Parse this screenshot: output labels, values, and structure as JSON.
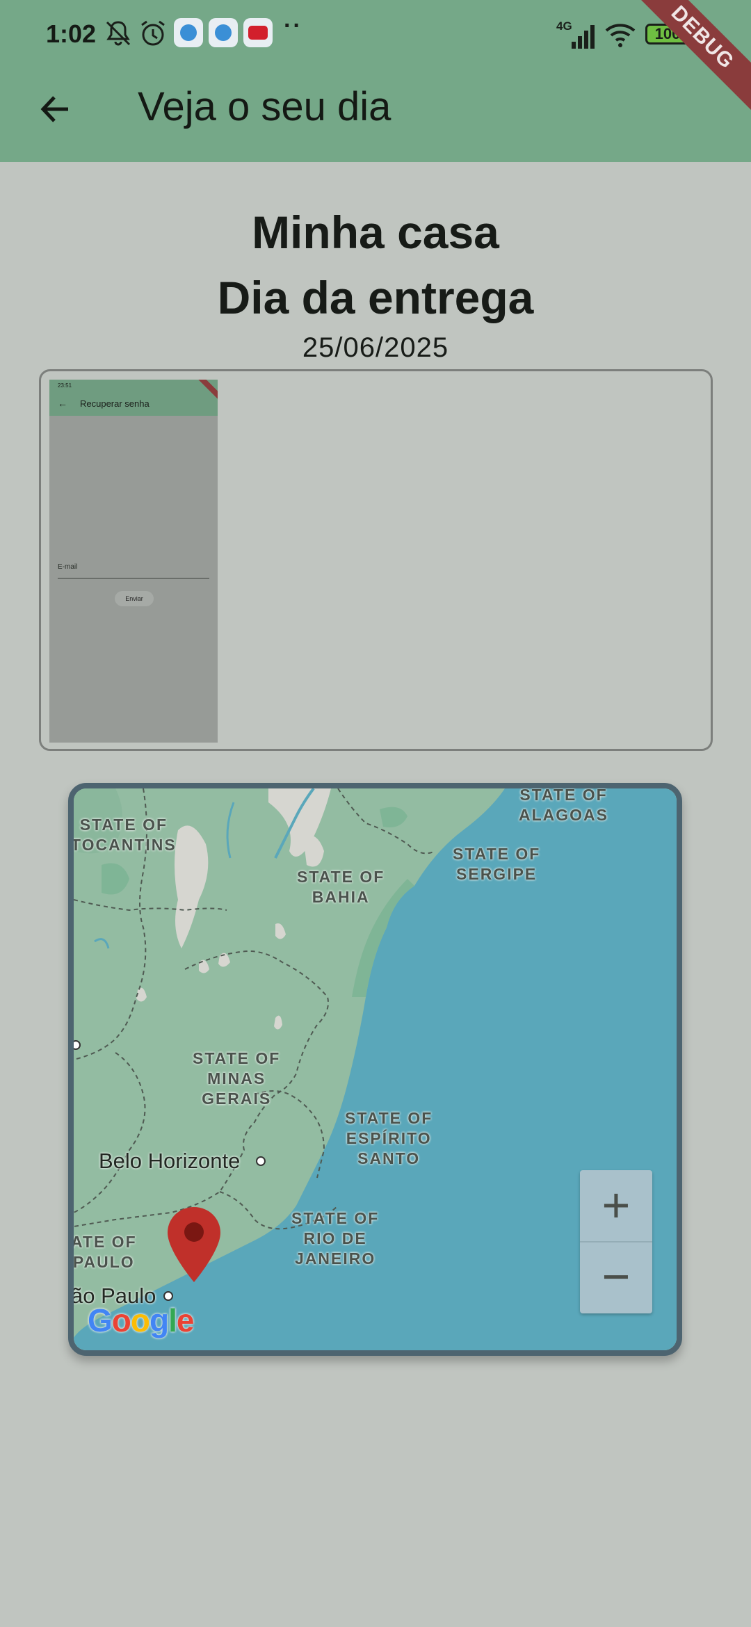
{
  "status_bar": {
    "time": "1:02",
    "network": "4G",
    "battery": "100",
    "icons": [
      "mute-icon",
      "alarm-icon",
      "edge-icon",
      "edge-icon",
      "youtube-icon",
      "more-dots-icon",
      "signal-icon",
      "wifi-icon",
      "battery-icon"
    ]
  },
  "debug_banner": "DEBUG",
  "app_bar": {
    "title": "Veja o seu dia",
    "back_icon": "arrow-back-icon"
  },
  "header": {
    "title_line1": "Minha casa",
    "title_line2": "Dia da entrega",
    "date": "25/06/2025"
  },
  "image_thumbnail": {
    "status_time": "23:51",
    "title": "Recuperar senha",
    "field_label": "E-mail",
    "button_label": "Enviar"
  },
  "map": {
    "labels": {
      "tocantins": "STATE OF\nTOCANTINS",
      "bahia": "STATE OF\nBAHIA",
      "alagoas": "STATE OF\nALAGOAS",
      "sergipe": "STATE OF\nSERGIPE",
      "minas": "STATE OF\nMINAS\nGERAIS",
      "espirito": "STATE OF\nESPÍRITO\nSANTO",
      "rio": "STATE OF\nRIO DE\nJANEIRO",
      "saopaulo_state": "ATE OF\nPAULO"
    },
    "cities": {
      "belo_horizonte": "Belo Horizonte",
      "sao_paulo": "ão Paulo"
    },
    "zoom_in": "+",
    "zoom_out": "−",
    "attribution": "Google",
    "colors": {
      "land": "#93bca2",
      "ocean": "#5aa7ba",
      "marker": "#c0302a"
    }
  }
}
